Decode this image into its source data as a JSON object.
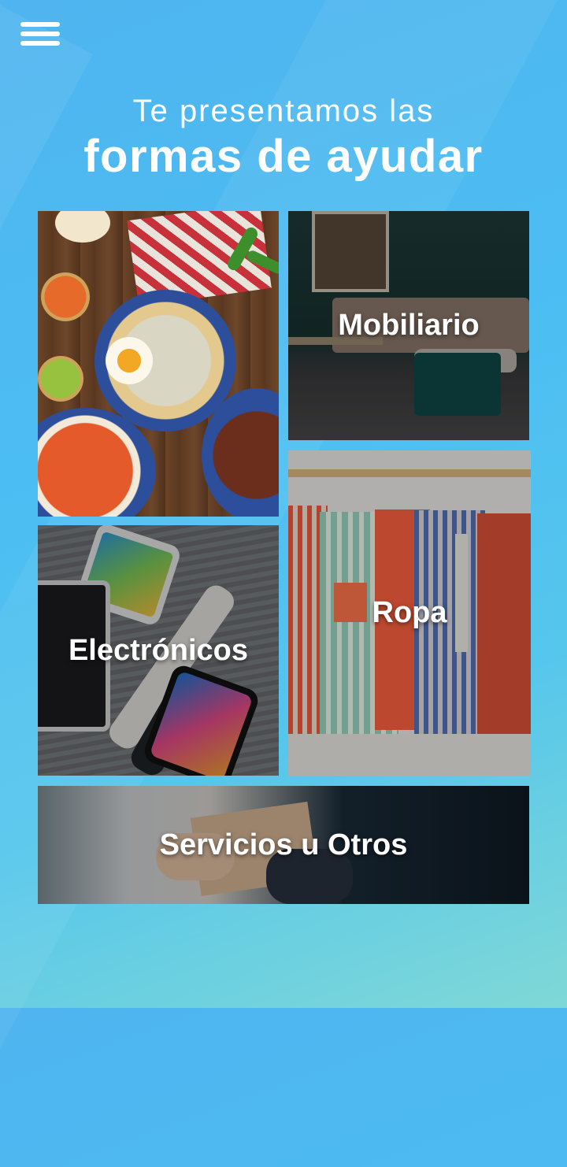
{
  "header": {
    "line1": "Te presentamos las",
    "line2": "formas de ayudar"
  },
  "menu": {
    "icon": "hamburger-menu-icon"
  },
  "tiles": [
    {
      "id": "food",
      "label": ""
    },
    {
      "id": "furniture",
      "label": "Mobiliario"
    },
    {
      "id": "electronics",
      "label": "Electrónicos"
    },
    {
      "id": "clothes",
      "label": "Ropa"
    },
    {
      "id": "services",
      "label": "Servicios u Otros"
    }
  ],
  "colors": {
    "background_start": "#4fb4ef",
    "background_end": "#7fd8d6",
    "text": "#ffffff"
  }
}
